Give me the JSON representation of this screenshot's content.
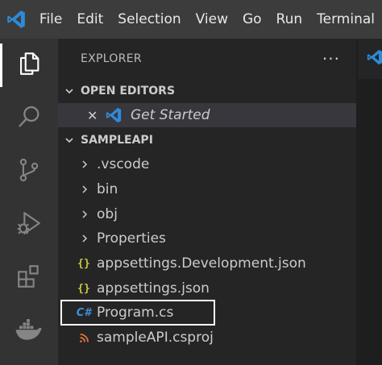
{
  "menu": [
    "File",
    "Edit",
    "Selection",
    "View",
    "Go",
    "Run",
    "Terminal"
  ],
  "sidebar": {
    "title": "EXPLORER",
    "more_actions": "···"
  },
  "open_editors": {
    "title": "OPEN EDITORS",
    "items": [
      {
        "label": "Get Started",
        "close": "✕"
      }
    ]
  },
  "workspace": {
    "title": "SAMPLEAPI",
    "folders": [
      ".vscode",
      "bin",
      "obj",
      "Properties"
    ],
    "files": [
      {
        "label": "appsettings.Development.json",
        "badge": "{}"
      },
      {
        "label": "appsettings.json",
        "badge": "{}"
      },
      {
        "label": "Program.cs",
        "badge": "C#"
      },
      {
        "label": "sampleAPI.csproj",
        "badge": ""
      }
    ]
  },
  "colors": {
    "accent": "#3c8fd6",
    "json": "#cbcb41",
    "rss": "#e37933",
    "highlight": "#ffffff"
  }
}
